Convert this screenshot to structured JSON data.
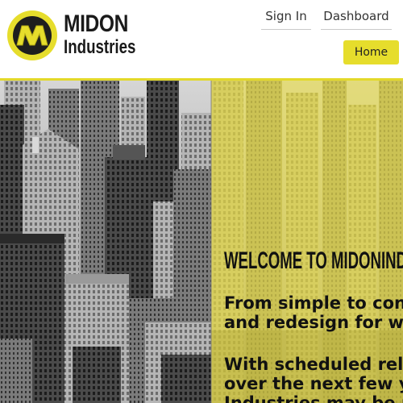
{
  "brand": {
    "logo_letter": "M",
    "name_line1": "MIDON",
    "name_line2": "Industries",
    "accent_color": "#e6dd2c",
    "dark_color": "#1a1a1a"
  },
  "nav": {
    "sign_in": "Sign In",
    "dashboard": "Dashboard",
    "home": "Home"
  },
  "hero": {
    "heading": "WELCOME TO MIDONIND",
    "intro_lines": [
      "From simple to con",
      "and redesign for w"
    ],
    "schedule_lines": [
      "With scheduled rel",
      "over the next few y",
      "Industries may be r"
    ],
    "background": "city-skyline-photo"
  }
}
